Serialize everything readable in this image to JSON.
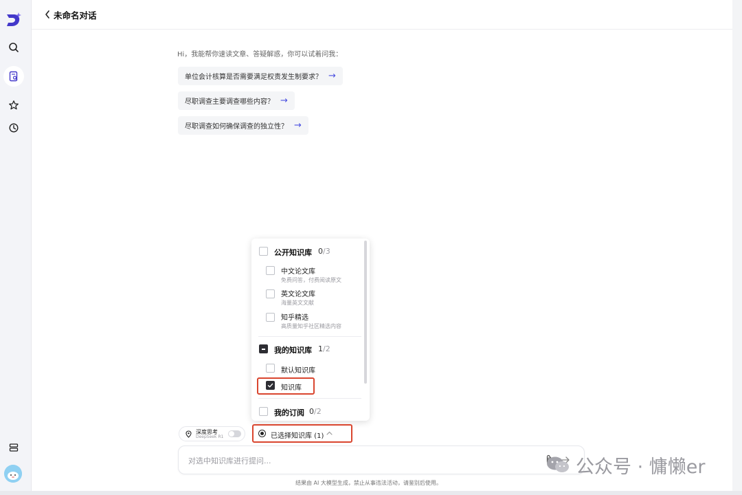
{
  "header": {
    "title": "未命名对话"
  },
  "sidebar": {
    "icons": [
      {
        "name": "logo",
        "label": ""
      },
      {
        "name": "search-icon"
      },
      {
        "name": "document-search-icon",
        "active": true
      },
      {
        "name": "star-icon"
      },
      {
        "name": "history-icon"
      },
      {
        "name": "layers-icon"
      },
      {
        "name": "avatar"
      }
    ]
  },
  "main": {
    "greeting": "Hi，我能帮你速读文章、答疑解惑，你可以试着问我：",
    "suggestions": [
      {
        "text": "单位会计核算是否需要满足权责发生制要求？",
        "arrow": "→"
      },
      {
        "text": "尽职调查主要调查哪些内容？",
        "arrow": "→"
      },
      {
        "text": "尽职调查如何确保调查的独立性？",
        "arrow": "→"
      }
    ]
  },
  "knowledge_dropdown": {
    "groups": [
      {
        "label": "公开知识库",
        "selected": "0",
        "total": "/3",
        "state": "unchecked",
        "items": [
          {
            "label": "中文论文库",
            "sub": "免费问答，付费阅读原文",
            "checked": false
          },
          {
            "label": "英文论文库",
            "sub": "海量英文文献",
            "checked": false
          },
          {
            "label": "知乎精选",
            "sub": "高质量知乎社区精选内容",
            "checked": false
          }
        ]
      },
      {
        "label": "我的知识库",
        "selected": "1",
        "total": "/2",
        "state": "partial",
        "items": [
          {
            "label": "默认知识库",
            "checked": false
          },
          {
            "label": "知识库",
            "checked": true
          }
        ]
      },
      {
        "label": "我的订阅",
        "selected": "0",
        "total": "/2",
        "state": "unchecked",
        "items": []
      }
    ]
  },
  "controls": {
    "deep_think_title": "深度思考",
    "deep_think_sub": "DeepSeek R1",
    "deep_think_enabled": false,
    "kb_selected_label": "已选择知识库 (1)"
  },
  "input": {
    "placeholder": "对选中知识库进行提问..."
  },
  "footer": {
    "disclaimer": "结果由 AI 大模型生成，禁止从事违法活动，请鉴别后使用。"
  },
  "watermark": {
    "text": "公众号 · 慵懒er"
  },
  "colors": {
    "accent": "#4a4fe0",
    "highlight_box": "#d9452e",
    "checkbox_checked": "#2d2d33"
  }
}
